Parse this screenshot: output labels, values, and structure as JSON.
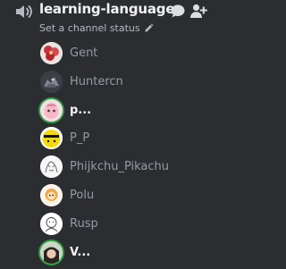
{
  "channel": {
    "name": "learning-language",
    "status_placeholder": "Set a channel status",
    "icon": "speaker-icon"
  },
  "header_actions": [
    {
      "icon": "chat-bubble-icon"
    },
    {
      "icon": "add-member-icon"
    }
  ],
  "members": [
    {
      "name": "Gent",
      "active": false,
      "avatar": "red-blossom-avatar"
    },
    {
      "name": "Huntercn",
      "active": false,
      "avatar": "dark-creature-avatar"
    },
    {
      "name": "p...",
      "active": true,
      "avatar": "pink-character-avatar"
    },
    {
      "name": "P_P",
      "active": false,
      "avatar": "yellow-face-avatar"
    },
    {
      "name": "Phijkchu_Pikachu",
      "active": false,
      "avatar": "sketch-avatar"
    },
    {
      "name": "Polu",
      "active": false,
      "avatar": "orange-character-avatar"
    },
    {
      "name": "Rusp",
      "active": false,
      "avatar": "doodle-avatar"
    },
    {
      "name": "V...",
      "active": true,
      "avatar": "dark-hair-avatar"
    }
  ],
  "colors": {
    "background": "#2b2d31",
    "text_primary": "#f2f3f5",
    "text_muted": "#949ba4",
    "speaking_ring": "#2ea043"
  }
}
